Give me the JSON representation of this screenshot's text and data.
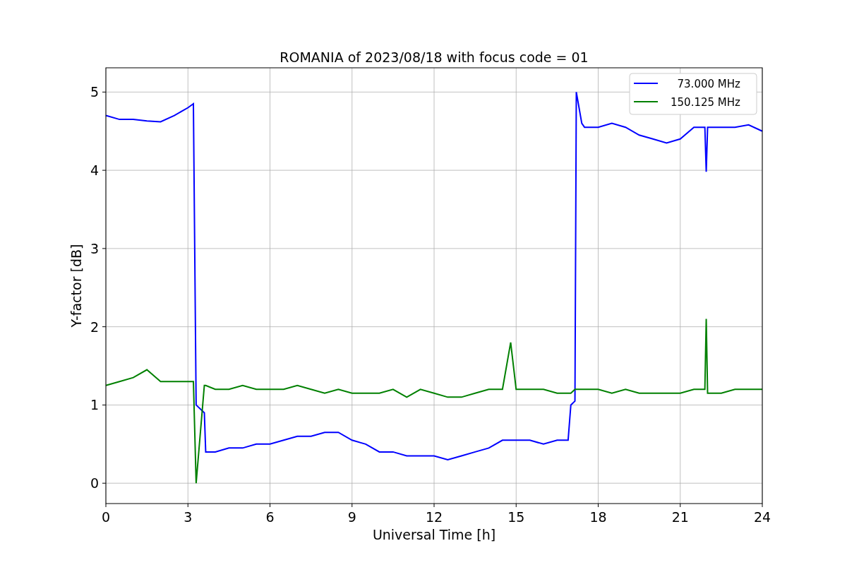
{
  "figure": {
    "chart_data": {
      "type": "line",
      "title": "ROMANIA of 2023/08/18 with focus code = 01",
      "xlabel": "Universal Time [h]",
      "ylabel": "Y-factor [dB]",
      "x": [
        0,
        0.5,
        1,
        1.5,
        2,
        2.5,
        3,
        3.2,
        3.3,
        3.6,
        3.65,
        4,
        4.5,
        5,
        5.5,
        6,
        6.5,
        7,
        7.5,
        8,
        8.5,
        9,
        9.5,
        10,
        10.5,
        11,
        11.5,
        12,
        12.5,
        13,
        13.5,
        14,
        14.5,
        14.8,
        15,
        15.5,
        16,
        16.5,
        16.9,
        17,
        17.15,
        17.2,
        17.4,
        17.5,
        18,
        18.5,
        19,
        19.5,
        20,
        20.5,
        21,
        21.5,
        21.9,
        21.95,
        22,
        22.5,
        23,
        23.5,
        24
      ],
      "series": [
        {
          "name": "  73.000 MHz",
          "color": "#0000ff",
          "values": [
            4.7,
            4.65,
            4.65,
            4.63,
            4.62,
            4.7,
            4.8,
            4.85,
            1.0,
            0.9,
            0.4,
            0.4,
            0.45,
            0.45,
            0.5,
            0.5,
            0.55,
            0.6,
            0.6,
            0.65,
            0.65,
            0.55,
            0.5,
            0.4,
            0.4,
            0.35,
            0.35,
            0.35,
            0.3,
            0.35,
            0.4,
            0.45,
            0.55,
            0.55,
            0.55,
            0.55,
            0.5,
            0.55,
            0.55,
            1.0,
            1.05,
            5.0,
            4.6,
            4.55,
            4.55,
            4.6,
            4.55,
            4.45,
            4.4,
            4.35,
            4.4,
            4.55,
            4.55,
            3.98,
            4.55,
            4.55,
            4.55,
            4.58,
            4.5
          ]
        },
        {
          "name": "150.125 MHz",
          "color": "#008000",
          "values": [
            1.25,
            1.3,
            1.35,
            1.45,
            1.3,
            1.3,
            1.3,
            1.3,
            0.0,
            1.25,
            1.25,
            1.2,
            1.2,
            1.25,
            1.2,
            1.2,
            1.2,
            1.25,
            1.2,
            1.15,
            1.2,
            1.15,
            1.15,
            1.15,
            1.2,
            1.1,
            1.2,
            1.15,
            1.1,
            1.1,
            1.15,
            1.2,
            1.2,
            1.8,
            1.2,
            1.2,
            1.2,
            1.15,
            1.15,
            1.15,
            1.2,
            1.2,
            1.2,
            1.2,
            1.2,
            1.15,
            1.2,
            1.15,
            1.15,
            1.15,
            1.15,
            1.2,
            1.2,
            2.1,
            1.15,
            1.15,
            1.2,
            1.2,
            1.2
          ]
        }
      ],
      "grid": true,
      "legend": "upper right",
      "xlim": [
        0,
        24
      ],
      "ylim": [
        -0.26,
        5.31
      ],
      "xticks": [
        0,
        3,
        6,
        9,
        12,
        15,
        18,
        21,
        24
      ],
      "yticks": [
        0,
        1,
        2,
        3,
        4,
        5
      ]
    }
  }
}
